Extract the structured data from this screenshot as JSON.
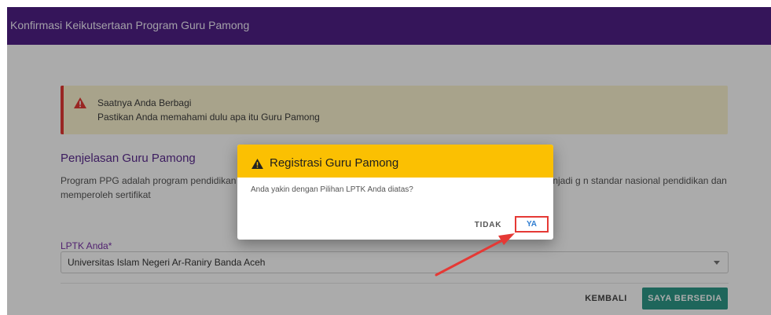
{
  "header": {
    "title": "Konfirmasi Keikutsertaan Program Guru Pamong"
  },
  "alert": {
    "title": "Saatnya Anda Berbagi",
    "body": "Pastikan Anda memahami dulu apa itu Guru Pamong",
    "icon": "warning-icon",
    "accent_color": "#e53935"
  },
  "section": {
    "title": "Penjelasan Guru Pamong",
    "paragraph": "Program PPG adalah program pendidikan y                                                                                                                         dikan yang memiliki bakat dan minat menjadi guru agar mereka dapat menjadi g                                                                                         n standar nasional pendidikan dan memperoleh sertifikat"
  },
  "form": {
    "lptk_label": "LPTK Anda*",
    "lptk_value": "Universitas Islam Negeri Ar-Raniry Banda Aceh"
  },
  "actions": {
    "back_label": "KEMBALI",
    "agree_label": "SAYA BERSEDIA",
    "agree_color": "#2e9988"
  },
  "dialog": {
    "title": "Registrasi Guru Pamong",
    "icon": "warning-icon",
    "message": "Anda yakin dengan Pilihan LPTK Anda diatas?",
    "no_label": "TIDAK",
    "yes_label": "YA",
    "header_color": "#fbc002",
    "highlight_color": "#e53935"
  }
}
